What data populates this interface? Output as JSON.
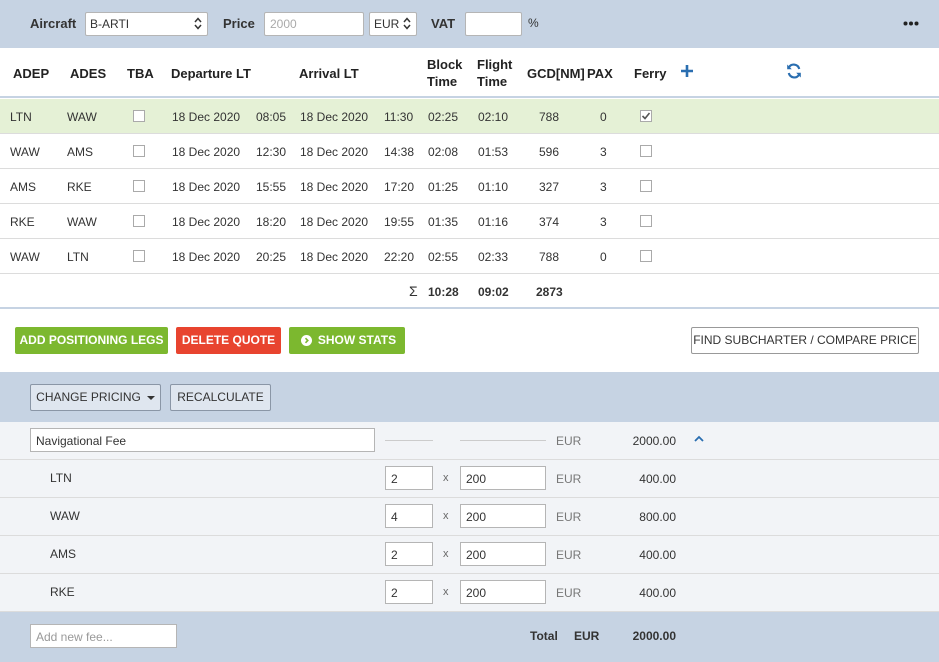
{
  "topbar": {
    "aircraft_label": "Aircraft",
    "aircraft_value": "B-ARTI",
    "price_label": "Price",
    "price_placeholder": "2000",
    "currency": "EUR",
    "vat_label": "VAT",
    "vat_value": "",
    "percent": "%"
  },
  "legs_table": {
    "headers": {
      "adep": "ADEP",
      "ades": "ADES",
      "tba": "TBA",
      "departure": "Departure LT",
      "arrival": "Arrival LT",
      "block_1": "Block",
      "block_2": "Time",
      "flight_1": "Flight",
      "flight_2": "Time",
      "gcd": "GCD[NM]",
      "pax": "PAX",
      "ferry": "Ferry"
    },
    "rows": [
      {
        "adep": "LTN",
        "ades": "WAW",
        "tba": false,
        "dep_date": "18 Dec 2020",
        "dep_time": "08:05",
        "arr_date": "18 Dec 2020",
        "arr_time": "11:30",
        "block": "02:25",
        "flight": "02:10",
        "gcd": "788",
        "pax": "0",
        "ferry": true,
        "selected": true
      },
      {
        "adep": "WAW",
        "ades": "AMS",
        "tba": false,
        "dep_date": "18 Dec 2020",
        "dep_time": "12:30",
        "arr_date": "18 Dec 2020",
        "arr_time": "14:38",
        "block": "02:08",
        "flight": "01:53",
        "gcd": "596",
        "pax": "3",
        "ferry": false,
        "selected": false
      },
      {
        "adep": "AMS",
        "ades": "RKE",
        "tba": false,
        "dep_date": "18 Dec 2020",
        "dep_time": "15:55",
        "arr_date": "18 Dec 2020",
        "arr_time": "17:20",
        "block": "01:25",
        "flight": "01:10",
        "gcd": "327",
        "pax": "3",
        "ferry": false,
        "selected": false
      },
      {
        "adep": "RKE",
        "ades": "WAW",
        "tba": false,
        "dep_date": "18 Dec 2020",
        "dep_time": "18:20",
        "arr_date": "18 Dec 2020",
        "arr_time": "19:55",
        "block": "01:35",
        "flight": "01:16",
        "gcd": "374",
        "pax": "3",
        "ferry": false,
        "selected": false
      },
      {
        "adep": "WAW",
        "ades": "LTN",
        "tba": false,
        "dep_date": "18 Dec 2020",
        "dep_time": "20:25",
        "arr_date": "18 Dec 2020",
        "arr_time": "22:20",
        "block": "02:55",
        "flight": "02:33",
        "gcd": "788",
        "pax": "0",
        "ferry": false,
        "selected": false
      }
    ],
    "totals": {
      "sigma": "Σ",
      "block": "10:28",
      "flight": "09:02",
      "gcd": "2873"
    }
  },
  "actions": {
    "add_positioning": "ADD POSITIONING LEGS",
    "delete_quote": "DELETE QUOTE",
    "show_stats": "SHOW STATS",
    "find_subcharter": "FIND SUBCHARTER / COMPARE PRICE"
  },
  "pricing": {
    "change_pricing": "CHANGE PRICING",
    "recalculate": "RECALCULATE",
    "fee": {
      "name": "Navigational Fee",
      "currency": "EUR",
      "amount": "2000.00"
    },
    "sub_items": [
      {
        "label": "LTN",
        "qty": "2",
        "x": "x",
        "rate": "200",
        "currency": "EUR",
        "amount": "400.00"
      },
      {
        "label": "WAW",
        "qty": "4",
        "x": "x",
        "rate": "200",
        "currency": "EUR",
        "amount": "800.00"
      },
      {
        "label": "AMS",
        "qty": "2",
        "x": "x",
        "rate": "200",
        "currency": "EUR",
        "amount": "400.00"
      },
      {
        "label": "RKE",
        "qty": "2",
        "x": "x",
        "rate": "200",
        "currency": "EUR",
        "amount": "400.00"
      }
    ],
    "add_fee_placeholder": "Add new fee...",
    "total_label": "Total",
    "total_currency": "EUR",
    "total_amount": "2000.00"
  },
  "colors": {
    "band": "#c6d3e3",
    "selected_row": "#e5f1d6",
    "green_button": "#7cb82f",
    "red_button": "#e8442f",
    "icon_blue": "#2a6eb0"
  }
}
